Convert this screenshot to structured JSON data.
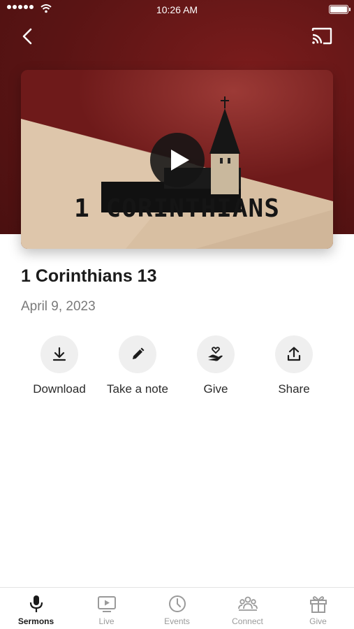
{
  "status_bar": {
    "time": "10:26 AM",
    "battery_level": 1.0
  },
  "header": {
    "back_icon": "chevron-left-icon",
    "cast_icon": "cast-icon"
  },
  "video": {
    "art_title": "1 CORINTHIANS",
    "play_icon": "play-icon"
  },
  "sermon": {
    "title": "1 Corinthians 13",
    "date": "April 9, 2023"
  },
  "actions": [
    {
      "label": "Download",
      "icon": "download-icon"
    },
    {
      "label": "Take a note",
      "icon": "pencil-icon"
    },
    {
      "label": "Give",
      "icon": "hand-heart-icon"
    },
    {
      "label": "Share",
      "icon": "share-icon"
    }
  ],
  "tabs": [
    {
      "label": "Sermons",
      "icon": "microphone-icon",
      "active": true
    },
    {
      "label": "Live",
      "icon": "tv-play-icon",
      "active": false
    },
    {
      "label": "Events",
      "icon": "clock-icon",
      "active": false
    },
    {
      "label": "Connect",
      "icon": "people-icon",
      "active": false
    },
    {
      "label": "Give",
      "icon": "gift-icon",
      "active": false
    }
  ],
  "colors": {
    "hero_background": "#5a1414",
    "active_tab": "#1a1a1a",
    "inactive_tab": "#9a9a9a"
  }
}
